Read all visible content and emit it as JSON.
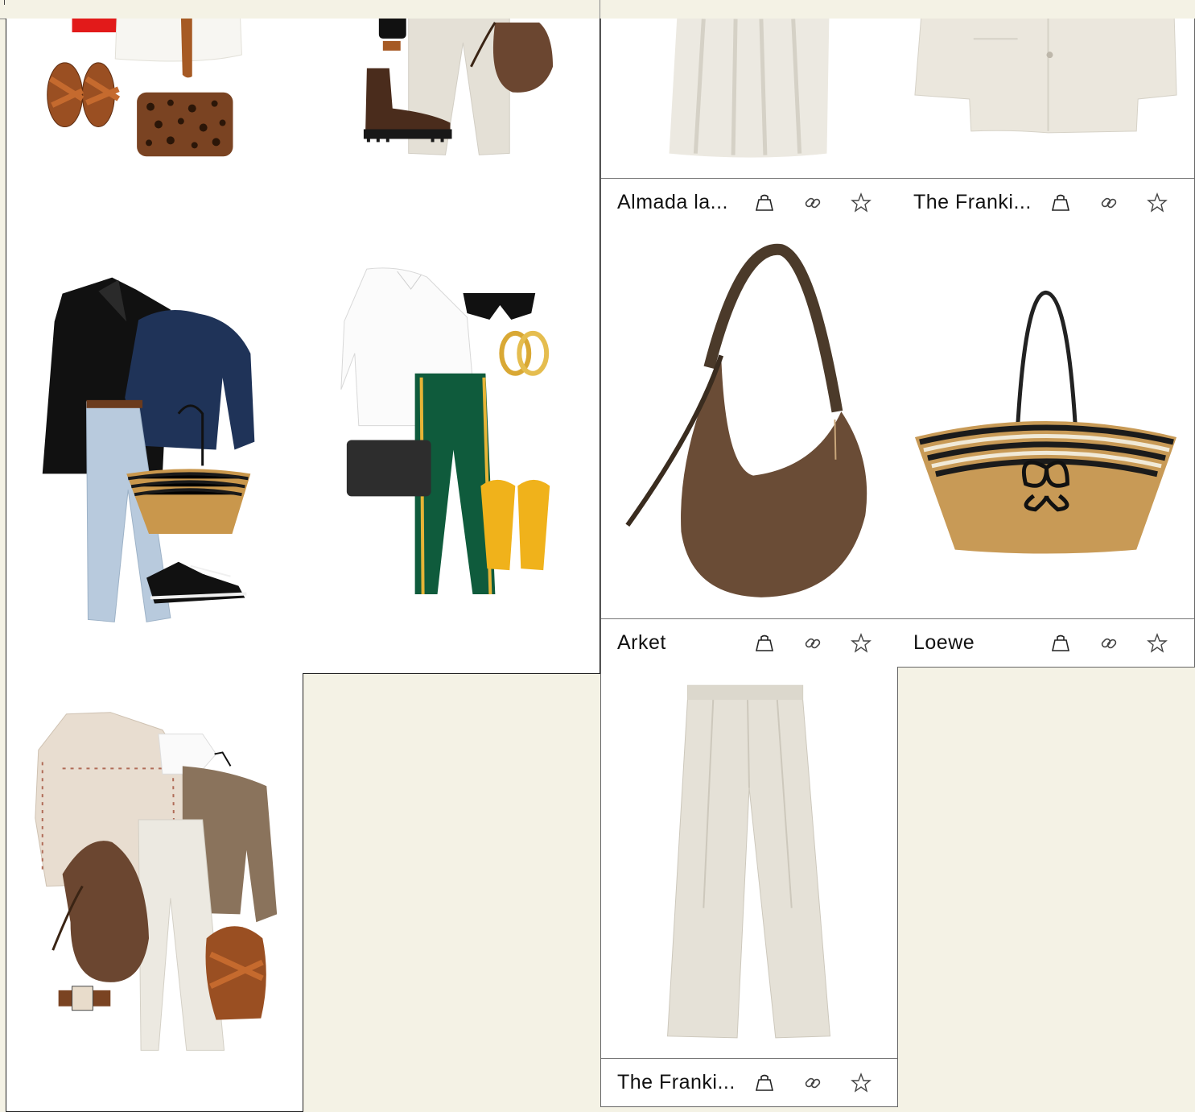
{
  "colors": {
    "background": "#f4f2e5",
    "card": "#ffffff",
    "border": "#222222"
  },
  "looks": [
    {
      "items": [
        "white-shorts",
        "brown-sandals",
        "leopard-crossbody-bag",
        "brown-belt"
      ]
    },
    {
      "items": [
        "smartwatch",
        "chelsea-boots",
        "beige-trousers",
        "suede-hobo-bag"
      ]
    },
    {
      "items": [
        "black-blazer",
        "navy-sweater",
        "light-wash-jeans",
        "striped-basket-tote",
        "black-sneakers",
        "belt"
      ]
    },
    {
      "items": [
        "white-shirt",
        "sunglasses",
        "gold-hoops",
        "green-track-pants",
        "black-crossbody-bag",
        "yellow-flip-flops"
      ]
    },
    {
      "items": [
        "embroidered-denim-jacket",
        "white-tee",
        "taupe-sweater",
        "satin-trousers",
        "suede-hobo-bag",
        "brown-sandals",
        "watch"
      ]
    }
  ],
  "products": [
    {
      "name": "Almada la...",
      "image": "cream-satin-skirt",
      "icons": [
        "shopping-bag-icon",
        "link-icon",
        "star-icon"
      ]
    },
    {
      "name": "The Franki...",
      "image": "cream-blazer",
      "icons": [
        "shopping-bag-icon",
        "link-icon",
        "star-icon"
      ]
    },
    {
      "name": "Arket",
      "image": "brown-suede-hobo-bag",
      "icons": [
        "shopping-bag-icon",
        "link-icon",
        "star-icon"
      ]
    },
    {
      "name": "Loewe",
      "image": "striped-raffia-basket-bag",
      "icons": [
        "shopping-bag-icon",
        "link-icon",
        "star-icon"
      ]
    },
    {
      "name": "The Franki...",
      "image": "cream-wide-leg-trousers",
      "icons": [
        "shopping-bag-icon",
        "link-icon",
        "star-icon"
      ]
    }
  ]
}
